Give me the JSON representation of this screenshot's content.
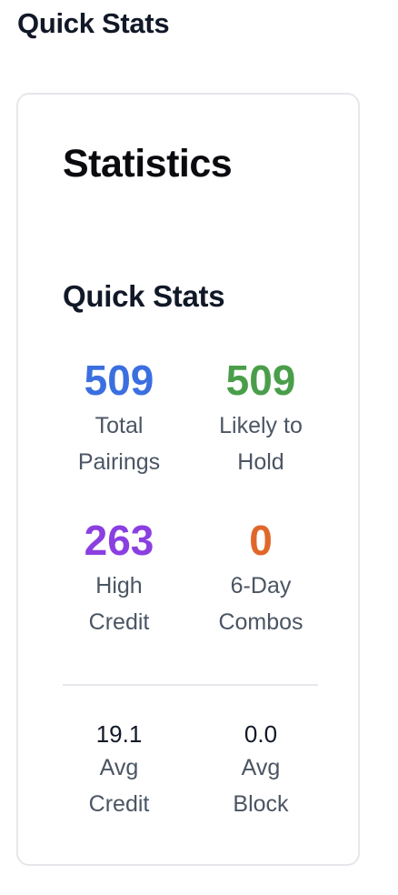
{
  "page": {
    "heading": "Quick Stats"
  },
  "card": {
    "title": "Statistics",
    "section_title": "Quick Stats",
    "stats": [
      {
        "value": "509",
        "label_line1": "Total",
        "label_line2": "Pairings",
        "color": "#3b6fe0"
      },
      {
        "value": "509",
        "label_line1": "Likely to",
        "label_line2": "Hold",
        "color": "#4a9e4a"
      },
      {
        "value": "263",
        "label_line1": "High",
        "label_line2": "Credit",
        "color": "#8b3fe0"
      },
      {
        "value": "0",
        "label_line1": "6-Day",
        "label_line2": "Combos",
        "color": "#e0662a"
      }
    ],
    "averages": [
      {
        "value": "19.1",
        "label_line1": "Avg",
        "label_line2": "Credit"
      },
      {
        "value": "0.0",
        "label_line1": "Avg",
        "label_line2": "Block"
      }
    ]
  }
}
